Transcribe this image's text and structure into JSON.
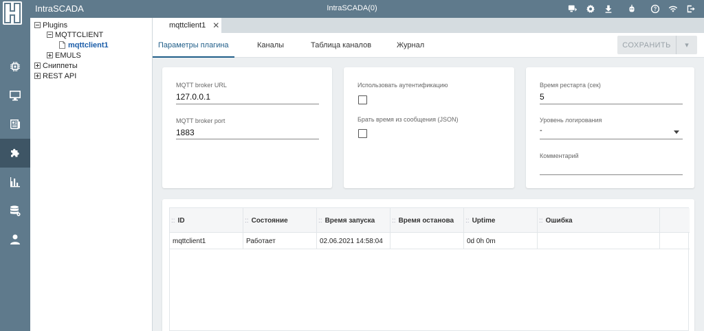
{
  "app": {
    "title": "IntraSCADA",
    "center_title": "IntraSCADA(0)"
  },
  "topbar_icons": [
    "monitor-export-icon",
    "gear-icon",
    "download-icon",
    "robot-icon",
    "help-icon",
    "wifi-icon",
    "logout-icon"
  ],
  "rail_icons": [
    "chip-icon",
    "monitor-icon",
    "newspaper-icon",
    "puzzle-icon",
    "bar-chart-icon",
    "database-icon",
    "user-icon"
  ],
  "tree": {
    "plugins": "Plugins",
    "mqttclient": "MQTTCLIENT",
    "mqttclient1": "mqttclient1",
    "emuls": "EMULS",
    "snippets": "Сниппеты",
    "restapi": "REST API"
  },
  "doc_tab": {
    "label": "mqttclient1",
    "close": "✕"
  },
  "subtabs": {
    "params": "Параметры плагина",
    "channels": "Каналы",
    "channel_table": "Таблица каналов",
    "journal": "Журнал"
  },
  "save": {
    "label": "СОХРАНИТЬ",
    "dropdown": "▾"
  },
  "card1": {
    "url_label": "MQTT broker URL",
    "url_value": "127.0.0.1",
    "port_label": "MQTT broker port",
    "port_value": "1883"
  },
  "card2": {
    "auth_label": "Использовать аутентификацию",
    "time_label": "Брать время из сообщения (JSON)"
  },
  "card3": {
    "restart_label": "Время рестарта (сек)",
    "restart_value": "5",
    "log_label": "Уровень логирования",
    "log_value": "-",
    "comment_label": "Комментарий",
    "comment_value": ""
  },
  "table": {
    "grip": "::",
    "headers": {
      "id": "ID",
      "state": "Состояние",
      "start": "Время запуска",
      "stop": "Время останова",
      "uptime": "Uptime",
      "error": "Ошибка"
    },
    "rows": [
      {
        "id": "mqttclient1",
        "state": "Работает",
        "start": "02.06.2021 14:58:04",
        "stop": "",
        "uptime": "0d 0h 0m",
        "error": ""
      }
    ]
  }
}
